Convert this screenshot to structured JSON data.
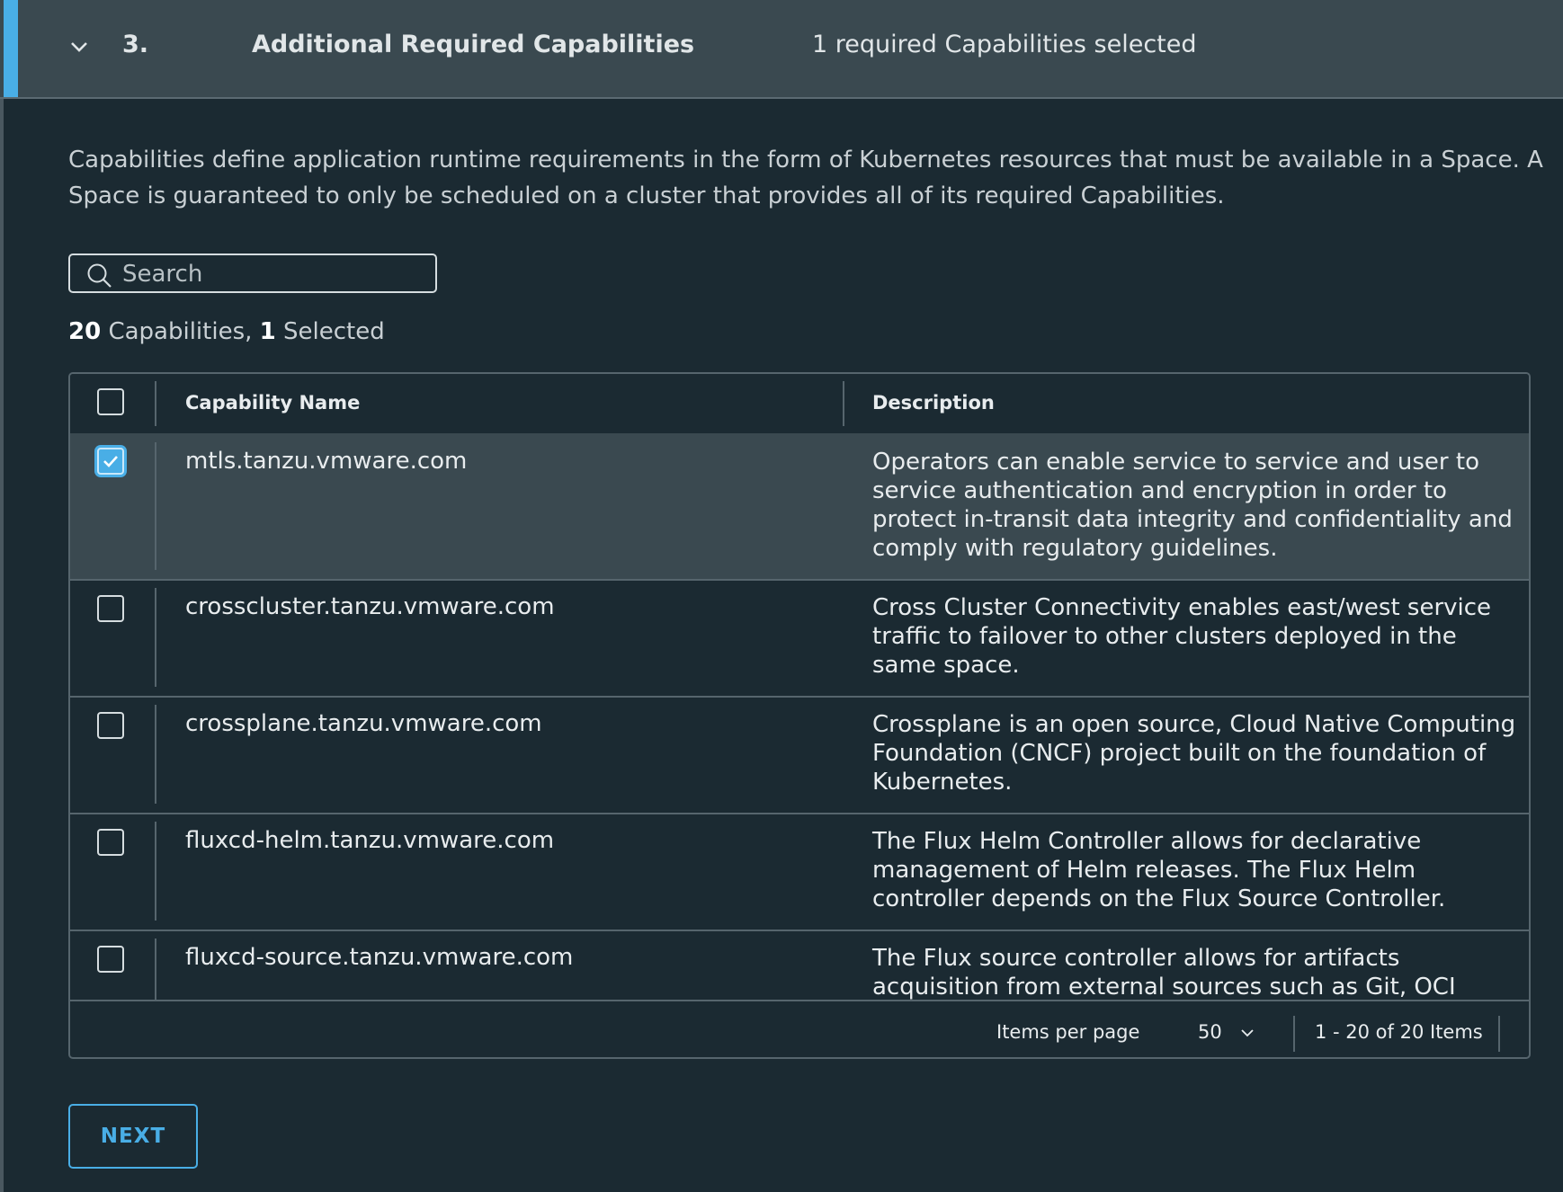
{
  "header": {
    "step": "3.",
    "title": "Additional Required Capabilities",
    "summary": "1 required Capabilities selected"
  },
  "description": "Capabilities define application runtime requirements in the form of Kubernetes resources that must be available in a Space. A Space is guaranteed to only be scheduled on a cluster that provides all of its required Capabilities.",
  "search": {
    "placeholder": "Search",
    "value": ""
  },
  "count": {
    "total": "20",
    "total_label": " Capabilities, ",
    "selected": "1",
    "selected_label": " Selected"
  },
  "table": {
    "columns": [
      "Capability Name",
      "Description"
    ],
    "rows": [
      {
        "name": "mtls.tanzu.vmware.com",
        "description": "Operators can enable service to service and user to service authentication and encryption in order to protect in-transit data integrity and confidentiality and comply with regulatory guidelines.",
        "checked": true
      },
      {
        "name": "crosscluster.tanzu.vmware.com",
        "description": "Cross Cluster Connectivity enables east/west service traffic to failover to other clusters deployed in the same space.",
        "checked": false
      },
      {
        "name": "crossplane.tanzu.vmware.com",
        "description": "Crossplane is an open source, Cloud Native Computing Foundation (CNCF) project built on the foundation of Kubernetes.",
        "checked": false
      },
      {
        "name": "fluxcd-helm.tanzu.vmware.com",
        "description": "The Flux Helm Controller allows for declarative management of Helm releases. The Flux Helm controller depends on the Flux Source Controller.",
        "checked": false
      },
      {
        "name": "fluxcd-source.tanzu.vmware.com",
        "description": "The Flux source controller allows for artifacts acquisition from external sources such as Git, OCI",
        "checked": false
      }
    ]
  },
  "pagination": {
    "items_per_page_label": "Items per page",
    "items_per_page_value": "50",
    "range": "1 - 20 of 20 Items"
  },
  "next_label": "NEXT",
  "colors": {
    "accent": "#49aee6",
    "background": "#1b2a32",
    "header": "#3a4950"
  }
}
